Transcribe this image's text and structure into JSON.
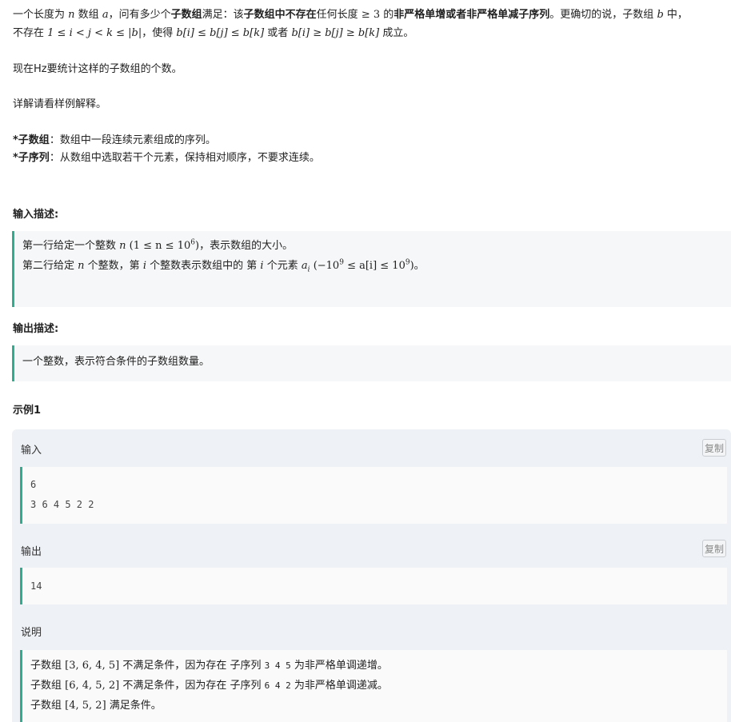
{
  "statement": {
    "p1": {
      "a": "一个长度为",
      "n": "n",
      "b": "数组",
      "arr": "a",
      "c": "，问有多少个",
      "bold1": "子数组",
      "d": "满足：该",
      "bold2": "子数组中不存在",
      "e": "任何长度",
      "ge3": "≥ 3",
      "f": "的",
      "bold3": "非严格单增或者非严格单减子序列",
      "g": "。更确切的说，子数组",
      "bvar": "b",
      "h": "中，"
    },
    "p2": {
      "a": "不存在",
      "cond": "1 ≤ i < j < k ≤ |b|",
      "b": "，使得",
      "inc": "b[i] ≤ b[j] ≤ b[k]",
      "c": "或者",
      "dec": "b[i] ≥ b[j] ≥ b[k]",
      "d": "成立。"
    },
    "p3": "现在Hz要统计这样的子数组的个数。",
    "p4": "详解请看样例解释。",
    "def1_term": "*子数组",
    "def1_text": "：数组中一段连续元素组成的序列。",
    "def2_term": "*子序列",
    "def2_text": "：从数组中选取若干个元素，保持相对顺序，不要求连续。"
  },
  "input_desc": {
    "title": "输入描述:",
    "l1a": "第一行给定一个整数",
    "l1n": "n",
    "l1range_pre": "(1 ≤ n ≤ 10",
    "l1exp": "6",
    "l1range_post": ")",
    "l1b": "，表示数组的大小。",
    "l2a": "第二行给定",
    "l2n": "n",
    "l2b": "个整数，第",
    "l2i": "i",
    "l2c": "个整数表示数组中的 第",
    "l2i2": "i",
    "l2d": "个元素",
    "l2ai": "a",
    "l2sub": "i",
    "l2r1": "(−10",
    "l2e1": "9",
    "l2r2": "≤ a[i] ≤ 10",
    "l2e2": "9",
    "l2r3": ")",
    "l2e": "。"
  },
  "output_desc": {
    "title": "输出描述:",
    "text": "一个整数，表示符合条件的子数组数量。"
  },
  "example": {
    "title": "示例1",
    "input_label": "输入",
    "copy_label": "复制",
    "input_lines": [
      "6",
      "3 6 4 5 2 2"
    ],
    "output_label": "输出",
    "output_lines": [
      "14"
    ],
    "explain_label": "说明",
    "explain": [
      {
        "a": "子数组",
        "arr": "[3, 6, 4, 5]",
        "b": "不满足条件，因为存在  子序列",
        "seq": "3 4 5",
        "c": "为非严格单调递增。"
      },
      {
        "a": "子数组",
        "arr": "[6, 4, 5, 2]",
        "b": "不满足条件，因为存在  子序列",
        "seq": "6 4 2",
        "c": "为非严格单调递减。"
      },
      {
        "a": "子数组",
        "arr": "[4, 5, 2]",
        "b": "满足条件。"
      }
    ]
  }
}
